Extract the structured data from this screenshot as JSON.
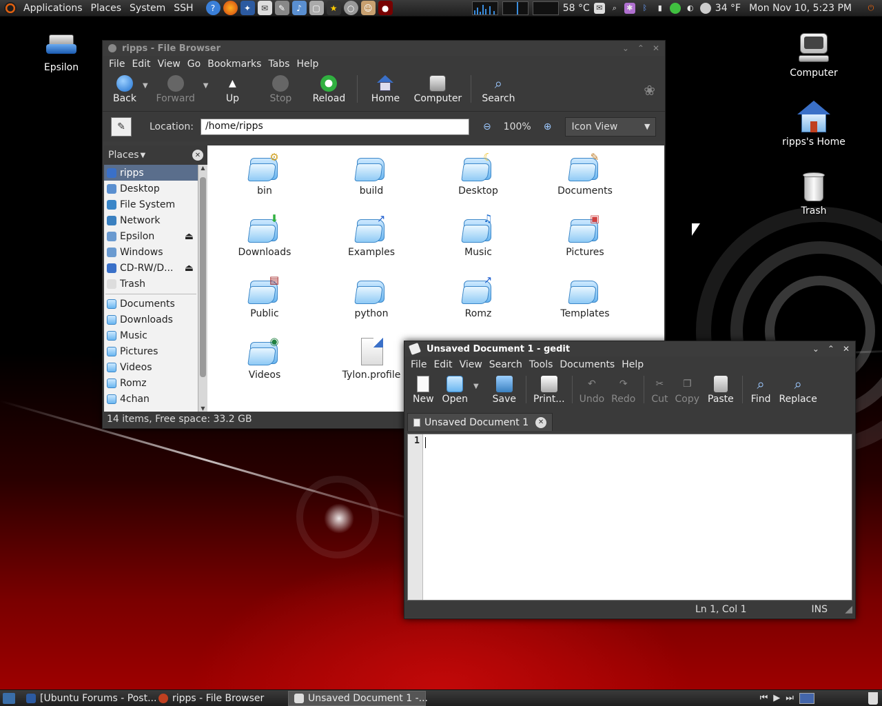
{
  "top_panel": {
    "menus": [
      "Applications",
      "Places",
      "System",
      "SSH"
    ],
    "cpu_temp": "58 °C",
    "weather": "34 °F",
    "clock": "Mon Nov 10,  5:23 PM"
  },
  "desktop_icons": {
    "epsilon": "Epsilon",
    "computer": "Computer",
    "home": "ripps's Home",
    "trash": "Trash"
  },
  "file_browser": {
    "title": "ripps - File Browser",
    "menus": [
      "File",
      "Edit",
      "View",
      "Go",
      "Bookmarks",
      "Tabs",
      "Help"
    ],
    "toolbar": {
      "back": "Back",
      "forward": "Forward",
      "up": "Up",
      "stop": "Stop",
      "reload": "Reload",
      "home": "Home",
      "computer": "Computer",
      "search": "Search"
    },
    "location_label": "Location:",
    "location_value": "/home/ripps",
    "zoom": "100%",
    "view_mode": "Icon View",
    "places_label": "Places",
    "sidebar": [
      {
        "label": "ripps",
        "icon": "home-icon",
        "selected": true
      },
      {
        "label": "Desktop",
        "icon": "desktop-icon"
      },
      {
        "label": "File System",
        "icon": "filesystem-icon"
      },
      {
        "label": "Network",
        "icon": "network-icon"
      },
      {
        "label": "Epsilon",
        "icon": "drive-icon",
        "eject": true
      },
      {
        "label": "Windows",
        "icon": "drive-icon"
      },
      {
        "label": "CD-RW/D...",
        "icon": "cdrom-icon",
        "eject": true
      },
      {
        "label": "Trash",
        "icon": "trash-icon"
      }
    ],
    "bookmarks": [
      "Documents",
      "Downloads",
      "Music",
      "Pictures",
      "Videos",
      "Romz",
      "4chan"
    ],
    "files": [
      {
        "name": "bin",
        "emblem": "⚙"
      },
      {
        "name": "build",
        "emblem": ""
      },
      {
        "name": "Desktop",
        "emblem": "☾"
      },
      {
        "name": "Documents",
        "emblem": "✎"
      },
      {
        "name": "Downloads",
        "emblem": "⬇"
      },
      {
        "name": "Examples",
        "emblem": "↗"
      },
      {
        "name": "Music",
        "emblem": "♫"
      },
      {
        "name": "Pictures",
        "emblem": "▣"
      },
      {
        "name": "Public",
        "emblem": "▤"
      },
      {
        "name": "python",
        "emblem": ""
      },
      {
        "name": "Romz",
        "emblem": "↗"
      },
      {
        "name": "Templates",
        "emblem": ""
      },
      {
        "name": "Videos",
        "emblem": "◉"
      },
      {
        "name": "Tylon.profile",
        "type": "file"
      }
    ],
    "status": "14 items, Free space: 33.2 GB"
  },
  "gedit": {
    "title": "Unsaved Document 1 - gedit",
    "menus": [
      "File",
      "Edit",
      "View",
      "Search",
      "Tools",
      "Documents",
      "Help"
    ],
    "toolbar": {
      "new": "New",
      "open": "Open",
      "save": "Save",
      "print": "Print...",
      "undo": "Undo",
      "redo": "Redo",
      "cut": "Cut",
      "copy": "Copy",
      "paste": "Paste",
      "find": "Find",
      "replace": "Replace"
    },
    "tab_label": "Unsaved Document 1",
    "line_number": "1",
    "status_position": "Ln 1, Col 1",
    "status_mode": "INS"
  },
  "taskbar": {
    "tasks": [
      "[Ubuntu Forums - Post...",
      "ripps - File Browser",
      "Unsaved Document 1 -..."
    ]
  }
}
